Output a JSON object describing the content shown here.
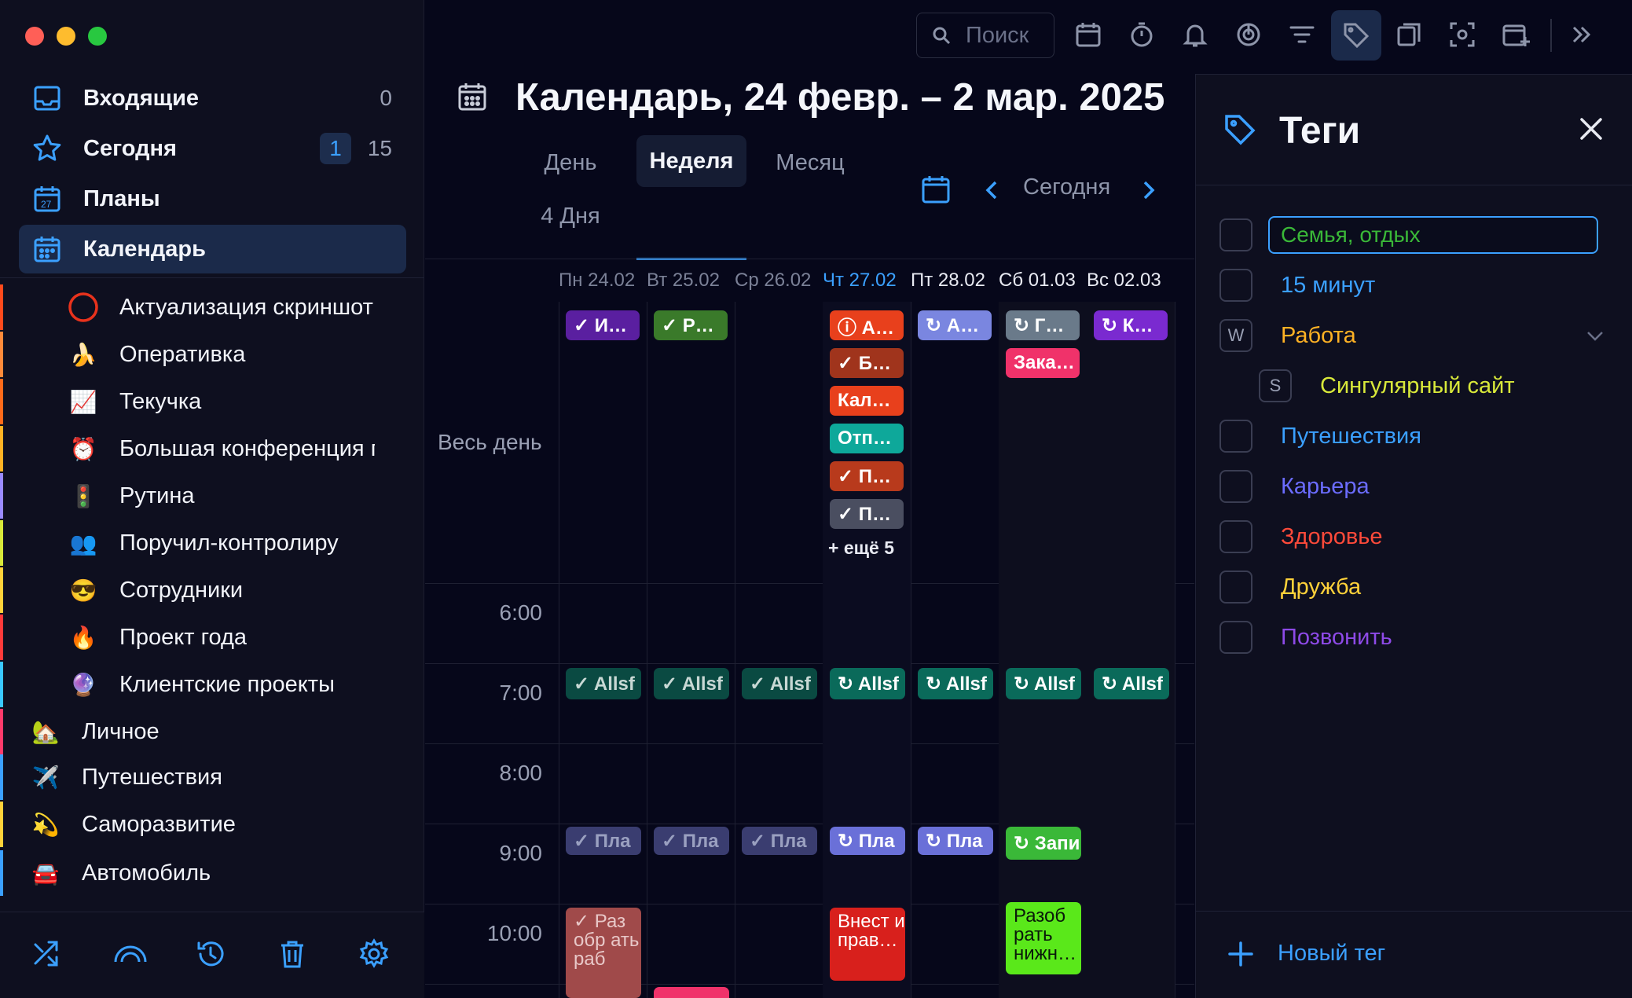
{
  "sidebar": {
    "nav": [
      {
        "label": "Входящие",
        "count": "0"
      },
      {
        "label": "Сегодня",
        "badge": "1",
        "count": "15"
      },
      {
        "label": "Планы"
      },
      {
        "label": "Календарь"
      }
    ],
    "projects": [
      {
        "emoji": "◯",
        "label": "Актуализация скриншот"
      },
      {
        "emoji": "🍌",
        "label": "Оперативка"
      },
      {
        "emoji": "📈",
        "label": "Текучка"
      },
      {
        "emoji": "⏰",
        "label": "Большая конференция г"
      },
      {
        "emoji": "🚦",
        "label": "Рутина"
      },
      {
        "emoji": "👥",
        "label": "Поручил-контролиру"
      },
      {
        "emoji": "😎",
        "label": "Сотрудники"
      },
      {
        "emoji": "🔥",
        "label": "Проект года"
      },
      {
        "emoji": "🔮",
        "label": "Клиентские проекты"
      },
      {
        "emoji": "🏡",
        "label": "Личное"
      },
      {
        "emoji": "✈️",
        "label": "Путешествия"
      },
      {
        "emoji": "💫",
        "label": "Саморазвитие"
      },
      {
        "emoji": "🚘",
        "label": "Автомобиль"
      }
    ]
  },
  "toolbar": {
    "search_placeholder": "Поиск"
  },
  "calendar": {
    "title": "Календарь, 24 февр. – 2 мар. 2025 г.",
    "tabs": [
      "День",
      "Неделя",
      "Месяц",
      "4 Дня"
    ],
    "today_label": "Сегодня",
    "allday_label": "Весь день",
    "days": [
      "Пн 24.02",
      "Вт 25.02",
      "Ср 26.02",
      "Чт 27.02",
      "Пт 28.02",
      "Сб 01.03",
      "Вс 02.03"
    ],
    "times": [
      "6:00",
      "7:00",
      "8:00",
      "9:00",
      "10:00"
    ],
    "more_label": "+ ещё 5",
    "allday_events": [
      {
        "text": "✓ И…"
      },
      {
        "text": "✓ Р…"
      },
      {
        "text": "ⓘ А…"
      },
      {
        "text": "✓ Б…"
      },
      {
        "text": "Кал…"
      },
      {
        "text": "Отп…"
      },
      {
        "text": "✓ П…"
      },
      {
        "text": "✓ П…"
      },
      {
        "text": "↻ А…"
      },
      {
        "text": "↻ Г…"
      },
      {
        "text": "Зака…"
      },
      {
        "text": "↻ К…"
      }
    ],
    "row7": [
      "✓ Allsf",
      "✓ Allsf",
      "✓ Allsf",
      "↻ Allsf",
      "↻ Allsf",
      "↻ Allsf",
      "↻ Allsf"
    ],
    "row9": [
      "✓ Пла",
      "✓ Пла",
      "✓ Пла",
      "↻ Пла",
      "↻ Пла",
      "↻ Запи"
    ],
    "row10": [
      "✓ Раз обр ать раб",
      "Внест и прав…",
      "Разоб рать нижн…"
    ]
  },
  "tags_panel": {
    "title": "Теги",
    "input_value": "Семья, отдых",
    "tags": [
      {
        "name": "15 минут",
        "color": "#3ba0ff"
      },
      {
        "name": "Работа",
        "color": "#ffb224",
        "letter": "W"
      },
      {
        "name": "Сингулярный сайт",
        "color": "#d8e83a",
        "letter": "S"
      },
      {
        "name": "Путешествия",
        "color": "#3ba0ff"
      },
      {
        "name": "Карьера",
        "color": "#6b6cff"
      },
      {
        "name": "Здоровье",
        "color": "#ff4a3a"
      },
      {
        "name": "Дружба",
        "color": "#ffd23a"
      },
      {
        "name": "Позвонить",
        "color": "#8e4ae8"
      }
    ],
    "new_tag": "Новый тег"
  }
}
